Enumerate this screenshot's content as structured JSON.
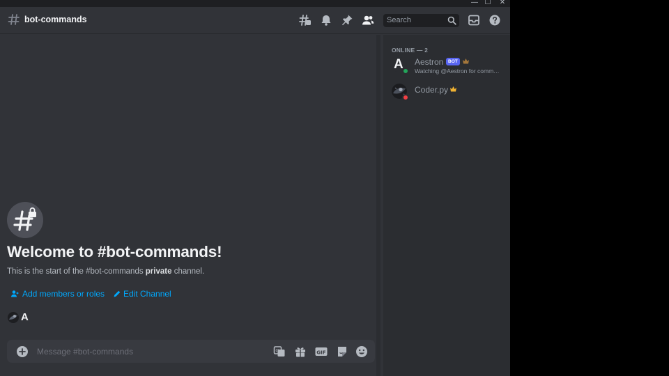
{
  "window": {
    "minimize": "—",
    "maximize": "☐",
    "close": "✕"
  },
  "header": {
    "channel_name": "bot-commands",
    "search": {
      "placeholder": "Search"
    },
    "icons": [
      "threads-icon",
      "bell-icon",
      "pin-icon",
      "members-icon",
      "inbox-icon",
      "help-icon"
    ]
  },
  "welcome": {
    "title": "Welcome to #bot-commands!",
    "sub_before": "This is the start of the #bot-commands ",
    "sub_bold": "private",
    "sub_after": " channel.",
    "add_members": "Add members or roles",
    "edit_channel": "Edit Channel",
    "typing_letter": "A"
  },
  "composer": {
    "placeholder": "Message #bot-commands"
  },
  "members": {
    "header": "ONLINE — 2",
    "list": [
      {
        "name": "Aestron",
        "bot_tag": "BOT",
        "status_text": "Watching @Aestron for comm…",
        "presence": "online",
        "avatar_letter": "A"
      },
      {
        "name": "Coder.py",
        "presence": "dnd"
      }
    ]
  },
  "colors": {
    "background": "#313338",
    "sidebar": "#2b2d31",
    "link": "#00a8fc",
    "online": "#23a55a",
    "dnd": "#f23f43",
    "bot_tag": "#5865f2",
    "crown": "#f0b232"
  }
}
